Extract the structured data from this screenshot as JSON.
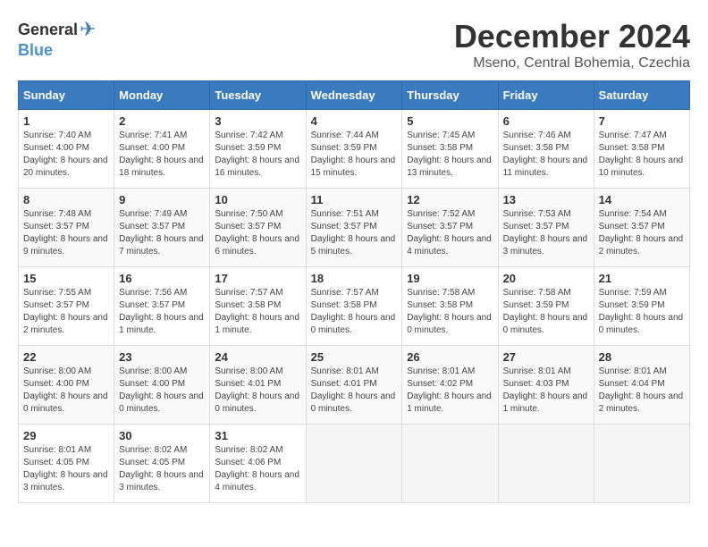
{
  "header": {
    "logo_general": "General",
    "logo_blue": "Blue",
    "month_title": "December 2024",
    "location": "Mseno, Central Bohemia, Czechia"
  },
  "weekdays": [
    "Sunday",
    "Monday",
    "Tuesday",
    "Wednesday",
    "Thursday",
    "Friday",
    "Saturday"
  ],
  "weeks": [
    [
      {
        "day": "1",
        "sunrise": "7:40 AM",
        "sunset": "4:00 PM",
        "daylight": "8 hours and 20 minutes."
      },
      {
        "day": "2",
        "sunrise": "7:41 AM",
        "sunset": "4:00 PM",
        "daylight": "8 hours and 18 minutes."
      },
      {
        "day": "3",
        "sunrise": "7:42 AM",
        "sunset": "3:59 PM",
        "daylight": "8 hours and 16 minutes."
      },
      {
        "day": "4",
        "sunrise": "7:44 AM",
        "sunset": "3:59 PM",
        "daylight": "8 hours and 15 minutes."
      },
      {
        "day": "5",
        "sunrise": "7:45 AM",
        "sunset": "3:58 PM",
        "daylight": "8 hours and 13 minutes."
      },
      {
        "day": "6",
        "sunrise": "7:46 AM",
        "sunset": "3:58 PM",
        "daylight": "8 hours and 11 minutes."
      },
      {
        "day": "7",
        "sunrise": "7:47 AM",
        "sunset": "3:58 PM",
        "daylight": "8 hours and 10 minutes."
      }
    ],
    [
      {
        "day": "8",
        "sunrise": "7:48 AM",
        "sunset": "3:57 PM",
        "daylight": "8 hours and 9 minutes."
      },
      {
        "day": "9",
        "sunrise": "7:49 AM",
        "sunset": "3:57 PM",
        "daylight": "8 hours and 7 minutes."
      },
      {
        "day": "10",
        "sunrise": "7:50 AM",
        "sunset": "3:57 PM",
        "daylight": "8 hours and 6 minutes."
      },
      {
        "day": "11",
        "sunrise": "7:51 AM",
        "sunset": "3:57 PM",
        "daylight": "8 hours and 5 minutes."
      },
      {
        "day": "12",
        "sunrise": "7:52 AM",
        "sunset": "3:57 PM",
        "daylight": "8 hours and 4 minutes."
      },
      {
        "day": "13",
        "sunrise": "7:53 AM",
        "sunset": "3:57 PM",
        "daylight": "8 hours and 3 minutes."
      },
      {
        "day": "14",
        "sunrise": "7:54 AM",
        "sunset": "3:57 PM",
        "daylight": "8 hours and 2 minutes."
      }
    ],
    [
      {
        "day": "15",
        "sunrise": "7:55 AM",
        "sunset": "3:57 PM",
        "daylight": "8 hours and 2 minutes."
      },
      {
        "day": "16",
        "sunrise": "7:56 AM",
        "sunset": "3:57 PM",
        "daylight": "8 hours and 1 minute."
      },
      {
        "day": "17",
        "sunrise": "7:57 AM",
        "sunset": "3:58 PM",
        "daylight": "8 hours and 1 minute."
      },
      {
        "day": "18",
        "sunrise": "7:57 AM",
        "sunset": "3:58 PM",
        "daylight": "8 hours and 0 minutes."
      },
      {
        "day": "19",
        "sunrise": "7:58 AM",
        "sunset": "3:58 PM",
        "daylight": "8 hours and 0 minutes."
      },
      {
        "day": "20",
        "sunrise": "7:58 AM",
        "sunset": "3:59 PM",
        "daylight": "8 hours and 0 minutes."
      },
      {
        "day": "21",
        "sunrise": "7:59 AM",
        "sunset": "3:59 PM",
        "daylight": "8 hours and 0 minutes."
      }
    ],
    [
      {
        "day": "22",
        "sunrise": "8:00 AM",
        "sunset": "4:00 PM",
        "daylight": "8 hours and 0 minutes."
      },
      {
        "day": "23",
        "sunrise": "8:00 AM",
        "sunset": "4:00 PM",
        "daylight": "8 hours and 0 minutes."
      },
      {
        "day": "24",
        "sunrise": "8:00 AM",
        "sunset": "4:01 PM",
        "daylight": "8 hours and 0 minutes."
      },
      {
        "day": "25",
        "sunrise": "8:01 AM",
        "sunset": "4:01 PM",
        "daylight": "8 hours and 0 minutes."
      },
      {
        "day": "26",
        "sunrise": "8:01 AM",
        "sunset": "4:02 PM",
        "daylight": "8 hours and 1 minute."
      },
      {
        "day": "27",
        "sunrise": "8:01 AM",
        "sunset": "4:03 PM",
        "daylight": "8 hours and 1 minute."
      },
      {
        "day": "28",
        "sunrise": "8:01 AM",
        "sunset": "4:04 PM",
        "daylight": "8 hours and 2 minutes."
      }
    ],
    [
      {
        "day": "29",
        "sunrise": "8:01 AM",
        "sunset": "4:05 PM",
        "daylight": "8 hours and 3 minutes."
      },
      {
        "day": "30",
        "sunrise": "8:02 AM",
        "sunset": "4:05 PM",
        "daylight": "8 hours and 3 minutes."
      },
      {
        "day": "31",
        "sunrise": "8:02 AM",
        "sunset": "4:06 PM",
        "daylight": "8 hours and 4 minutes."
      },
      null,
      null,
      null,
      null
    ]
  ]
}
